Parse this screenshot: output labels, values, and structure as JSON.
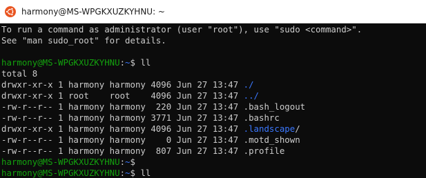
{
  "window": {
    "title": "harmony@MS-WPGKXUZKYHNU: ~",
    "accent_color": "#e95420",
    "icon": "ubuntu-icon"
  },
  "terminal": {
    "colors": {
      "background": "#0c0c0c",
      "foreground": "#cccccc",
      "prompt": "#13a10e",
      "directory": "#3b78ff"
    },
    "message": [
      "To run a command as administrator (user \"root\"), use \"sudo <command>\".",
      "See \"man sudo_root\" for details."
    ],
    "prompt1": {
      "user_host": "harmony@MS-WPGKXUZKYHNU",
      "sep": ":",
      "path": "~",
      "symbol": "$ ",
      "command": "ll"
    },
    "total": "total 8",
    "listing": [
      {
        "meta": "drwxr-xr-x 1 harmony harmony 4096 Jun 27 13:47 ",
        "name": "./",
        "dir": true
      },
      {
        "meta": "drwxr-xr-x 1 root    root    4096 Jun 27 13:47 ",
        "name": "../",
        "dir": true
      },
      {
        "meta": "-rw-r--r-- 1 harmony harmony  220 Jun 27 13:47 ",
        "name": ".bash_logout",
        "dir": false
      },
      {
        "meta": "-rw-r--r-- 1 harmony harmony 3771 Jun 27 13:47 ",
        "name": ".bashrc",
        "dir": false
      },
      {
        "meta": "drwxr-xr-x 1 harmony harmony 4096 Jun 27 13:47 ",
        "name": ".landscape",
        "dir": true
      },
      {
        "meta": "-rw-r--r-- 1 harmony harmony    0 Jun 27 13:47 ",
        "name": ".motd_shown",
        "dir": false
      },
      {
        "meta": "-rw-r--r-- 1 harmony harmony  807 Jun 27 13:47 ",
        "name": ".profile",
        "dir": false
      }
    ],
    "prompt2": {
      "user_host": "harmony@MS-WPGKXUZKYHNU",
      "sep": ":",
      "path": "~",
      "symbol": "$",
      "command": ""
    },
    "prompt3": {
      "user_host": "harmony@MS-WPGKXUZKYHNU",
      "sep": ":",
      "path": "~",
      "symbol": "$ ",
      "command": "ll"
    }
  }
}
